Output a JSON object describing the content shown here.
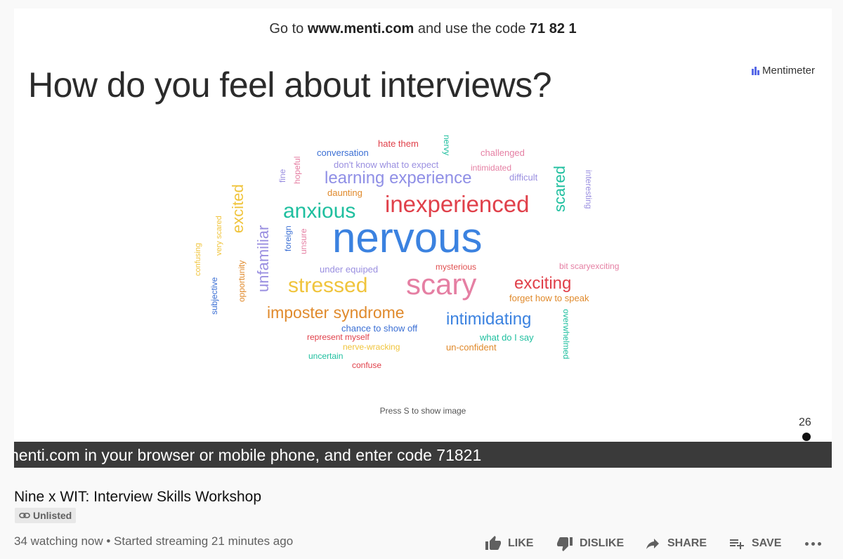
{
  "slide": {
    "join_prefix": "Go to ",
    "join_url": "www.menti.com",
    "join_middle": " and use the code ",
    "join_code": "71 82 1",
    "question": "How do you feel about interviews?",
    "brand": "Mentimeter",
    "hint": "Press S to show image",
    "viewer_count": "26",
    "words": {
      "hate_them": "hate them",
      "nervy": "nervy",
      "conversation": "conversation",
      "challenged": "challenged",
      "dont_know": "don't know what to expect",
      "intimidated": "intimidated",
      "fine": "fine",
      "hopeful": "hopeful",
      "learning_experience": "learning experience",
      "difficult": "difficult",
      "scared": "scared",
      "interesting": "interesting",
      "excited": "excited",
      "daunting": "daunting",
      "anxious": "anxious",
      "inexperienced": "inexperienced",
      "very_scared": "very scared",
      "unfamiliar": "unfamiliar",
      "foreign": "foreign",
      "unsure": "unsure",
      "nervous": "nervous",
      "confusing": "confusing",
      "opportunity": "opportunity",
      "under_equiped": "under equiped",
      "mysterious": "mysterious",
      "bit_scary": "bit scaryexciting",
      "subjective": "subjective",
      "stressed": "stressed",
      "scary": "scary",
      "exciting": "exciting",
      "forget": "forget how to speak",
      "imposter": "imposter syndrome",
      "intimidating": "intimidating",
      "overwhelmed": "overwhelmed",
      "chance": "chance to show off",
      "represent": "represent myself",
      "what_do_i_say": "what do I say",
      "nerve_wracking": "nerve-wracking",
      "un_confident": "un-confident",
      "uncertain": "uncertain",
      "confuse": "confuse"
    }
  },
  "caption": "nenti.com in your browser or mobile phone, and enter code 71821",
  "video": {
    "title": "Nine x WIT: Interview Skills Workshop",
    "visibility": "Unlisted",
    "stats": "34 watching now • Started streaming 21 minutes ago"
  },
  "actions": {
    "like": "LIKE",
    "dislike": "DISLIKE",
    "share": "SHARE",
    "save": "SAVE"
  },
  "icons": {
    "like": "thumbs-up-icon",
    "dislike": "thumbs-down-icon",
    "share": "share-arrow-icon",
    "save": "playlist-add-icon",
    "more": "more-horizontal-icon",
    "unlisted": "link-icon",
    "presenter": "person-icon"
  },
  "colors": {
    "brand": "#5769e7",
    "caption_bar": "#3a3a3a",
    "nervous": "#3b82e0",
    "scary": "#e57fa3",
    "inexperienced": "#e0404a",
    "anxious": "#1fbf9f",
    "stressed": "#f0c43c"
  }
}
